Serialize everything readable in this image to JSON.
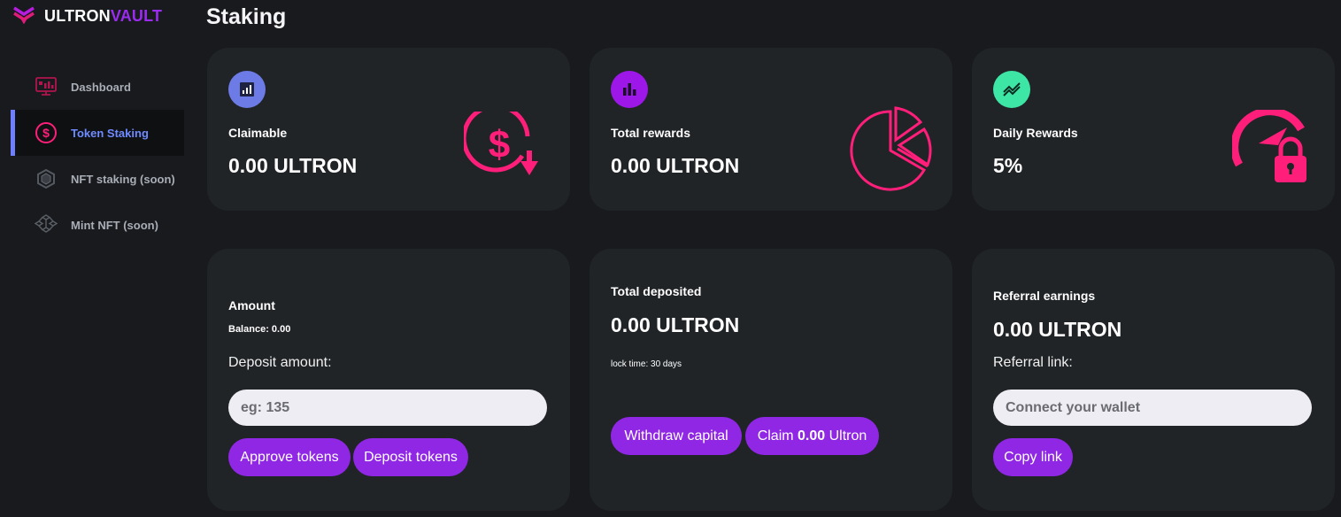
{
  "brand": {
    "part1": "ULTRON",
    "part2": "VAULT",
    "accent": "#9b2bf0"
  },
  "page": {
    "title": "Staking"
  },
  "sidebar": {
    "items": [
      {
        "label": "Dashboard",
        "icon": "dashboard-icon",
        "active": false
      },
      {
        "label": "Token Staking",
        "icon": "dollar-circle-icon",
        "active": true
      },
      {
        "label": "NFT staking (soon)",
        "icon": "nft-hex-icon",
        "active": false
      },
      {
        "label": "Mint NFT (soon)",
        "icon": "cube-network-icon",
        "active": false
      }
    ]
  },
  "stats": {
    "claimable": {
      "label": "Claimable",
      "value": "0.00 ULTRON",
      "icon": "bar-chart-icon",
      "illustration": "dollar-arrow-down-icon",
      "icon_bg": "#6d7be6"
    },
    "total_rewards": {
      "label": "Total rewards",
      "value": "0.00 ULTRON",
      "icon": "bar-chart-icon",
      "illustration": "pie-chart-icon",
      "icon_bg": "#9d17e8"
    },
    "daily_rewards": {
      "label": "Daily Rewards",
      "value": "5%",
      "icon": "trend-lines-icon",
      "illustration": "gauge-lock-icon",
      "icon_bg": "#3ee6a6"
    }
  },
  "deposit": {
    "amount_label": "Amount",
    "balance": "Balance: 0.00",
    "deposit_amount_label": "Deposit amount:",
    "input_placeholder": "eg: 135",
    "approve_button": "Approve tokens",
    "deposit_button": "Deposit tokens"
  },
  "deposited": {
    "label": "Total deposited",
    "value": "0.00 ULTRON",
    "lock_time": "lock time: 30 days",
    "withdraw_button": "Withdraw capital",
    "claim_prefix": "Claim",
    "claim_amount": "0.00",
    "claim_suffix": "Ultron"
  },
  "referral": {
    "label": "Referral earnings",
    "value": "0.00 ULTRON",
    "link_label": "Referral link:",
    "wallet_placeholder": "Connect your wallet",
    "copy_button": "Copy link"
  },
  "colors": {
    "pink": "#ff1f7a",
    "button": "#8f27e5",
    "card": "#202427",
    "background": "#181a1d"
  }
}
